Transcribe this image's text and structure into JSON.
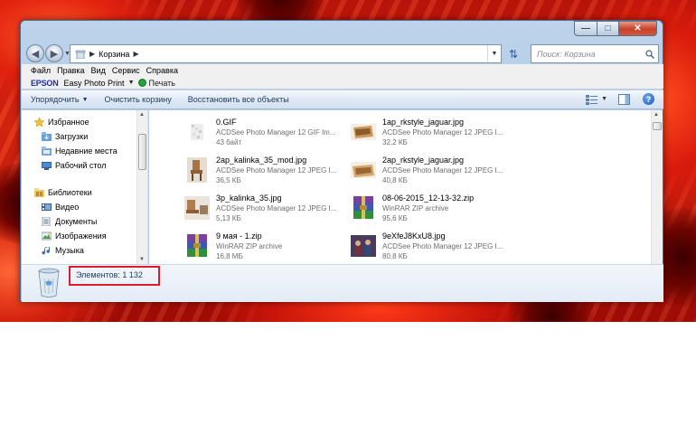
{
  "window": {
    "address_crumb": "Корзина",
    "search_placeholder": "Поиск: Корзина"
  },
  "menu": [
    "Файл",
    "Правка",
    "Вид",
    "Сервис",
    "Справка"
  ],
  "epson_bar": {
    "logo": "EPSON",
    "app": "Easy Photo Print",
    "print_label": "Печать"
  },
  "toolbar": {
    "organize": "Упорядочить",
    "empty_bin": "Очистить корзину",
    "restore_all": "Восстановить все объекты"
  },
  "sidebar": {
    "favorites_header": "Избранное",
    "favorites": [
      "Загрузки",
      "Недавние места",
      "Рабочий стол"
    ],
    "libraries_header": "Библиотеки",
    "libraries": [
      "Видео",
      "Документы",
      "Изображения",
      "Музыка"
    ]
  },
  "files": [
    {
      "name": "0.GIF",
      "type": "ACDSee Photo Manager 12 GIF Im...",
      "size": "43 байт",
      "thumb": "blurred-gif"
    },
    {
      "name": "1ap_rkstyle_jaguar.jpg",
      "type": "ACDSee Photo Manager 12 JPEG I...",
      "size": "32,2 КБ",
      "thumb": "cabinet-photo"
    },
    {
      "name": "2ap_kalinka_35_mod.jpg",
      "type": "ACDSee Photo Manager 12 JPEG I...",
      "size": "36,5 КБ",
      "thumb": "chair-photo"
    },
    {
      "name": "2ap_rkstyle_jaguar.jpg",
      "type": "ACDSee Photo Manager 12 JPEG I...",
      "size": "40,8 КБ",
      "thumb": "cabinet-photo"
    },
    {
      "name": "3p_kalinka_35.jpg",
      "type": "ACDSee Photo Manager 12 JPEG I...",
      "size": "5,13 КБ",
      "thumb": "chair-photo"
    },
    {
      "name": "08-06-2015_12-13-32.zip",
      "type": "WinRAR ZIP archive",
      "size": "95,6 КБ",
      "thumb": "winrar-icon"
    },
    {
      "name": "9 мая - 1.zip",
      "type": "WinRAR ZIP archive",
      "size": "16,8 МБ",
      "thumb": "winrar-icon"
    },
    {
      "name": "9eXfeJ8KxU8.jpg",
      "type": "ACDSee Photo Manager 12 JPEG I...",
      "size": "80,8 КБ",
      "thumb": "people-photo"
    }
  ],
  "status": {
    "items_count": "Элементов: 1 132"
  },
  "colors": {
    "highlight": "#e11b2b",
    "toolbar_text": "#1e395b"
  }
}
